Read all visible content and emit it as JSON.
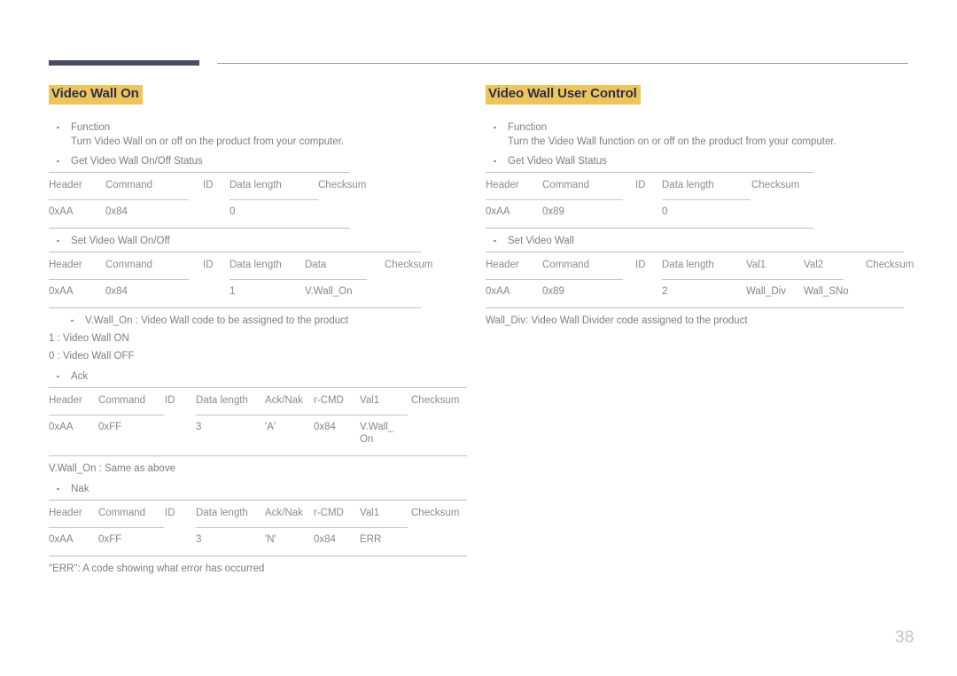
{
  "page": {
    "number": "38"
  },
  "left": {
    "heading": "Video Wall On",
    "function_label": "Function",
    "function_text": "Turn Video Wall on or off on the product from your computer.",
    "get_label": "Get Video Wall On/Off Status",
    "get_table": {
      "headers": [
        "Header",
        "Command",
        "ID",
        "Data length",
        "Checksum"
      ],
      "row": [
        "0xAA",
        "0x84",
        "",
        "0",
        ""
      ]
    },
    "set_label": "Set Video Wall On/Off",
    "set_table": {
      "headers": [
        "Header",
        "Command",
        "ID",
        "Data length",
        "Data",
        "Checksum"
      ],
      "row": [
        "0xAA",
        "0x84",
        "",
        "1",
        "V.Wall_On",
        ""
      ]
    },
    "vwall_note": "V.Wall_On : Video Wall code to be assigned to the product",
    "vwall_on_line": "1 : Video Wall ON",
    "vwall_off_line": "0 : Video Wall OFF",
    "ack_label": "Ack",
    "ack_table": {
      "headers": [
        "Header",
        "Command",
        "ID",
        "Data length",
        "Ack/Nak",
        "r-CMD",
        "Val1",
        "Checksum"
      ],
      "row": [
        "0xAA",
        "0xFF",
        "",
        "3",
        "'A'",
        "0x84",
        "V.Wall_\nOn",
        ""
      ]
    },
    "ack_note": "V.Wall_On : Same as above",
    "nak_label": "Nak",
    "nak_table": {
      "headers": [
        "Header",
        "Command",
        "ID",
        "Data length",
        "Ack/Nak",
        "r-CMD",
        "Val1",
        "Checksum"
      ],
      "row": [
        "0xAA",
        "0xFF",
        "",
        "3",
        "'N'",
        "0x84",
        "ERR",
        ""
      ]
    },
    "nak_note": "\"ERR\": A code showing what error has occurred"
  },
  "right": {
    "heading": "Video Wall User Control",
    "function_label": "Function",
    "function_text": "Turn the Video Wall function on or off on the product from your computer.",
    "get_label": "Get Video Wall Status",
    "get_table": {
      "headers": [
        "Header",
        "Command",
        "ID",
        "Data length",
        "Checksum"
      ],
      "row": [
        "0xAA",
        "0x89",
        "",
        "0",
        ""
      ]
    },
    "set_label": "Set Video Wall",
    "set_table": {
      "headers": [
        "Header",
        "Command",
        "ID",
        "Data length",
        "Val1",
        "Val2",
        "Checksum"
      ],
      "row": [
        "0xAA",
        "0x89",
        "",
        "2",
        "Wall_Div",
        "Wall_SNo",
        ""
      ]
    },
    "wall_div_note": "Wall_Div: Video Wall Divider code assigned to the product"
  },
  "colors": {
    "highlight": "#ecc65c",
    "heading_text": "#2f2f4a",
    "body_text": "#7d7d85",
    "rule_dark": "#494a63",
    "rule_light": "#bfbfc4"
  }
}
